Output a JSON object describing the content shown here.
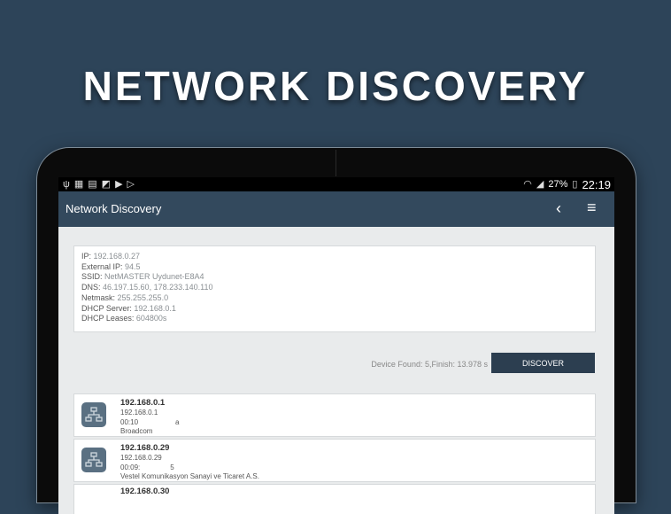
{
  "headline": "NETWORK DISCOVERY",
  "status_bar": {
    "icons_left": [
      "usb-icon",
      "image-icon",
      "sd-icon",
      "screenshot-icon",
      "play-icon",
      "play-store-icon"
    ],
    "battery": "27%",
    "time": "22:19"
  },
  "appbar": {
    "title": "Network Discovery"
  },
  "info": [
    {
      "label": "IP: ",
      "value": "192.168.0.27"
    },
    {
      "label": "External IP: ",
      "value": "94.5"
    },
    {
      "label": "SSID: ",
      "value": " NetMASTER Uydunet-E8A4"
    },
    {
      "label": "DNS: ",
      "value": "46.197.15.60, 178.233.140.110"
    },
    {
      "label": "Netmask: ",
      "value": "255.255.255.0"
    },
    {
      "label": "DHCP Server: ",
      "value": "192.168.0.1"
    },
    {
      "label": "DHCP Leases: ",
      "value": "604800s"
    }
  ],
  "found_text": "Device Found: 5,Finish: 13.978 s",
  "discover_label": "DISCOVER",
  "devices": [
    {
      "ip": "192.168.0.1",
      "line1": "192.168.0.1",
      "mac": "00:10",
      "mac_tail": "a",
      "vendor": "Broadcom"
    },
    {
      "ip": "192.168.0.29",
      "line1": "192.168.0.29",
      "mac": "00:09:",
      "mac_tail": "5",
      "vendor": "Vestel Komunikasyon Sanayi ve Ticaret A.S."
    },
    {
      "ip": "192.168.0.30",
      "line1": "",
      "mac": "",
      "mac_tail": "",
      "vendor": ""
    }
  ],
  "colors": {
    "background": "#2d4459",
    "appbar": "#33495d",
    "button": "#2c3e50"
  }
}
